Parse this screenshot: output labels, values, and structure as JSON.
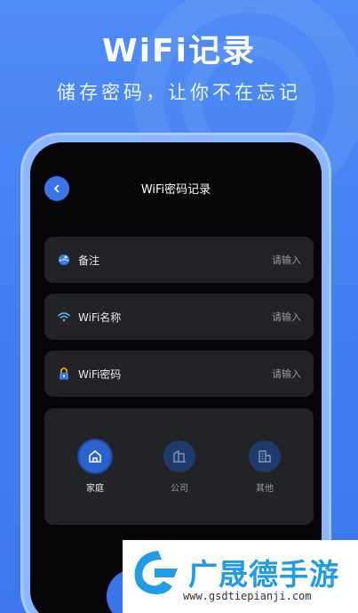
{
  "hero": {
    "title": "WiFi记录",
    "subtitle": "储存密码，让你不在忘记"
  },
  "screen": {
    "nav_title": "WiFi密码记录",
    "back_icon": "chevron-left-icon",
    "fields": [
      {
        "label": "备注",
        "placeholder": "请输入",
        "icon": "globe-icon"
      },
      {
        "label": "WiFi名称",
        "placeholder": "请输入",
        "icon": "wifi-icon"
      },
      {
        "label": "WiFi密码",
        "placeholder": "请输入",
        "icon": "lock-icon"
      }
    ],
    "categories": [
      {
        "label": "家庭",
        "icon": "home-icon",
        "selected": true
      },
      {
        "label": "公司",
        "icon": "office-icon",
        "selected": false
      },
      {
        "label": "其他",
        "icon": "building-icon",
        "selected": false
      }
    ]
  },
  "watermark": {
    "title": "广晟德手游",
    "url": "www.gsdtiepianji.com"
  },
  "colors": {
    "background": "#4f8cf6",
    "accent": "#3a74e9",
    "card": "#222327",
    "screen": "#060608"
  }
}
